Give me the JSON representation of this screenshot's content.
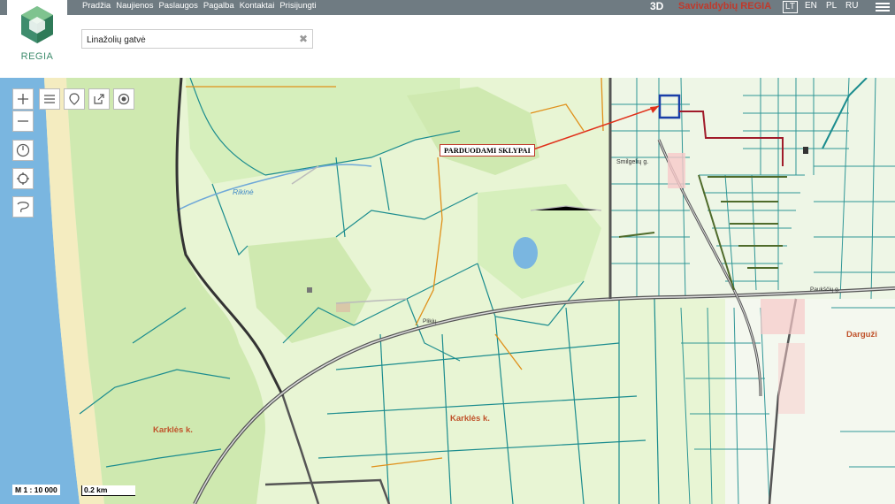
{
  "nav": {
    "items": [
      "Pradžia",
      "Naujienos",
      "Paslaugos",
      "Pagalba",
      "Kontaktai",
      "Prisijungti"
    ],
    "mode_3d": "3D",
    "brand": "Savivaldybių REGIA",
    "languages": [
      "LT",
      "EN",
      "PL",
      "RU"
    ],
    "active_language": "LT"
  },
  "logo": {
    "text": "REGIA",
    "color": "#3e8c6d"
  },
  "search": {
    "value": "Linažolių gatvė",
    "clear_icon": "close-icon"
  },
  "map": {
    "annotation": "PARDUODAMI SKLYPAI",
    "labels": {
      "stream": "Rikinė",
      "village1": "Karklės k.",
      "village2": "Karklės k.",
      "village3": "Darguži",
      "street1": "Smilgelių g.",
      "street2": "Paukščių g.",
      "street3": "Plikių"
    },
    "scale": {
      "ratio": "M 1 : 10 000",
      "bar": "0.2 km"
    },
    "colors": {
      "forest": "#cfe9b0",
      "open": "#e8f5d4",
      "sea": "#7ab6e0",
      "parcel": "#1b8c8e",
      "road": "#555555",
      "highlight": "#1a3ea8",
      "boundary": "#a01b2a"
    }
  },
  "tools": {
    "zoom_in": "plus-icon",
    "zoom_out": "minus-icon",
    "layers": "layers-icon",
    "locate": "pin-icon",
    "share": "share-icon",
    "target": "target-icon",
    "time": "clock-icon",
    "gps": "crosshair-icon",
    "draw": "lasso-icon"
  }
}
